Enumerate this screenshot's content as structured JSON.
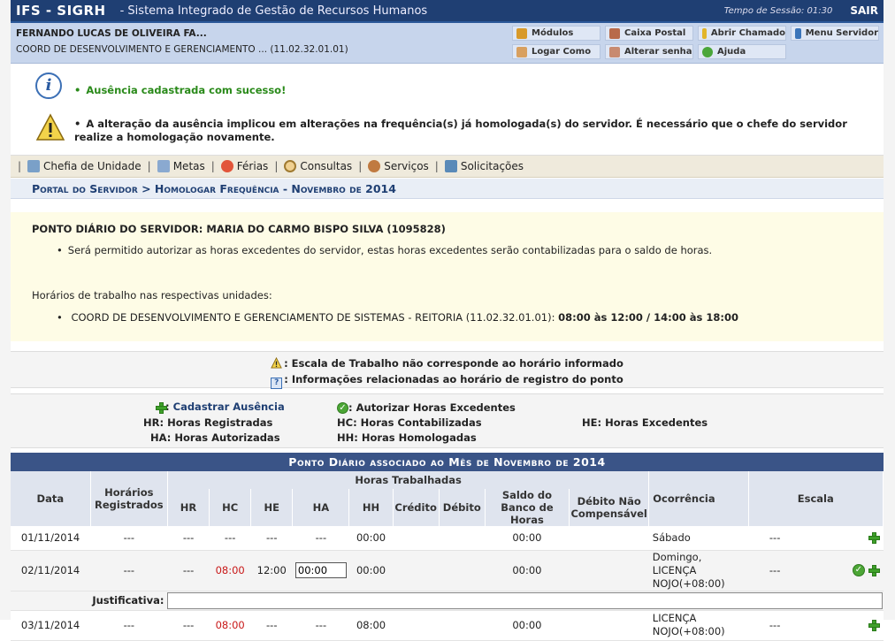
{
  "header": {
    "brand": "IFS - SIGRH",
    "subtitle": "- Sistema Integrado de Gestão de Recursos Humanos",
    "session_label": "Tempo de Sessão:",
    "session_time": "01:30",
    "logout": "SAIR"
  },
  "user": {
    "name": "FERNANDO LUCAS DE OLIVEIRA FA...",
    "unit": "COORD DE DESENVOLVIMENTO E GERENCIAMENTO ... (11.02.32.01.01)"
  },
  "menu_buttons": {
    "modulos": "Módulos",
    "caixa_postal": "Caixa Postal",
    "abrir_chamado": "Abrir Chamado",
    "menu_servidor": "Menu Servidor",
    "logar_como": "Logar Como",
    "alterar_senha": "Alterar senha",
    "ajuda": "Ajuda"
  },
  "messages": {
    "success": "Ausência cadastrada com sucesso!",
    "warning": "A alteração da ausência implicou em alterações na frequência(s) já homologada(s) do servidor. É necessário que o chefe do servidor realize a homologação novamente."
  },
  "nav": {
    "chefia": "Chefia de Unidade",
    "metas": "Metas",
    "ferias": "Férias",
    "consultas": "Consultas",
    "servicos": "Serviços",
    "solicitacoes": "Solicitações",
    "separator": "|"
  },
  "breadcrumb": "Portal do Servidor > Homologar Frequência - Novembro de 2014",
  "ponto_info": {
    "title": "PONTO DIÁRIO DO SERVIDOR: MARIA DO CARMO BISPO SILVA (1095828)",
    "bullet1": "Será permitido autorizar as horas excedentes do servidor, estas horas excedentes serão contabilizadas para o saldo de horas.",
    "horarios_heading": "Horários de trabalho nas respectivas unidades:",
    "unit_text": "COORD DE DESENVOLVIMENTO E GERENCIAMENTO DE SISTEMAS - REITORIA (11.02.32.01.01):",
    "unit_hours": "08:00 às 12:00 / 14:00 às 18:00"
  },
  "legend": {
    "escala": ": Escala de Trabalho não corresponde ao horário informado",
    "info": ": Informações relacionadas ao horário de registro do ponto",
    "cadastrar": "Cadastrar Ausência",
    "autorizar": ": Autorizar Horas Excedentes",
    "hr": "HR: Horas Registradas",
    "hc": "HC: Horas Contabilizadas",
    "he": "HE: Horas Excedentes",
    "ha": "HA: Horas Autorizadas",
    "hh": "HH: Horas Homologadas",
    "colon": ":"
  },
  "table": {
    "title": "Ponto Diário associado ao Mês de Novembro de 2014",
    "headers": {
      "data": "Data",
      "horarios": "Horários Registrados",
      "horas_trab": "Horas Trabalhadas",
      "hr": "HR",
      "hc": "HC",
      "he": "HE",
      "ha": "HA",
      "hh": "HH",
      "credito": "Crédito",
      "debito": "Débito",
      "saldo": "Saldo do Banco de Horas",
      "debito_nc": "Débito Não Compensável",
      "ocorrencia": "Ocorrência",
      "escala": "Escala"
    },
    "rows": [
      {
        "data": "01/11/2014",
        "horarios": "---",
        "hr": "---",
        "hc": "---",
        "he": "---",
        "ha": "---",
        "hh": "00:00",
        "saldo": "00:00",
        "ocorrencia": "Sábado",
        "escala": "---"
      },
      {
        "data": "02/11/2014",
        "horarios": "---",
        "hr": "---",
        "hc": "08:00",
        "he": "12:00",
        "ha_value": "00:00",
        "hh": "00:00",
        "saldo": "00:00",
        "ocorrencia": "Domingo, LICENÇA NOJO(+08:00)",
        "escala": "---"
      },
      {
        "data": "03/11/2014",
        "horarios": "---",
        "hr": "---",
        "hc": "08:00",
        "he": "---",
        "ha": "---",
        "hh": "08:00",
        "saldo": "00:00",
        "ocorrencia": "LICENÇA NOJO(+08:00)",
        "escala": "---"
      }
    ],
    "justificativa_label": "Justificativa:"
  },
  "colors": {
    "header_bg": "#1f3f73",
    "userbar_bg": "#c7d5ec",
    "success": "#2a8a1a",
    "table_title_bg": "#3a5487",
    "hc_red": "#c81818"
  }
}
